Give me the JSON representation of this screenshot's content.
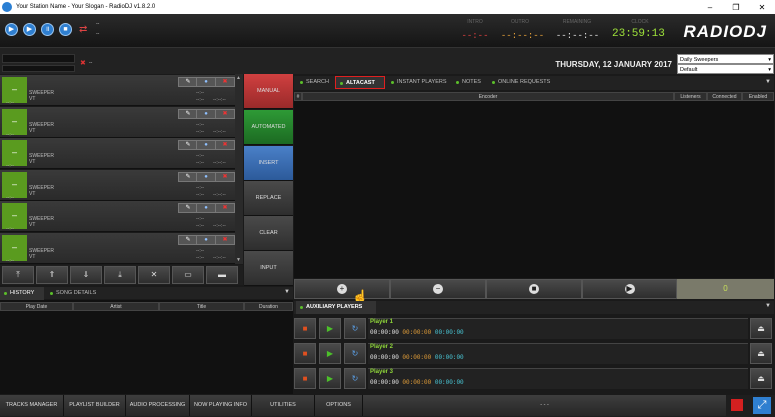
{
  "window": {
    "title": "Your Station Name - Your Slogan - RadioDJ v1.8.2.0",
    "min": "–",
    "max": "❐",
    "close": "✕"
  },
  "top": {
    "intro_label": "INTRO",
    "outro_label": "OUTRO",
    "remaining_label": "REMAINING",
    "clock_label": "CLOCK",
    "intro": "--:--",
    "outro": "--:--:--",
    "remaining": "--:--:--",
    "clock": "23:59:13",
    "logo": "RADIODJ",
    "player_label": "--",
    "player_label2": "--"
  },
  "date": "THURSDAY, 12 JANUARY 2017",
  "selectors": {
    "rotation": "Daily Sweepers",
    "mode": "Default"
  },
  "mini": {
    "value": "--"
  },
  "playlist": [
    {
      "title": "SWEEPER",
      "artist": "VT",
      "t1": "--:--",
      "t2": "--:--",
      "t3": "--:--",
      "t4": "--:--:--"
    },
    {
      "title": "SWEEPER",
      "artist": "VT",
      "t1": "--:--",
      "t2": "--:--",
      "t3": "--:--",
      "t4": "--:--:--"
    },
    {
      "title": "SWEEPER",
      "artist": "VT",
      "t1": "--:--",
      "t2": "--:--",
      "t3": "--:--",
      "t4": "--:--:--"
    },
    {
      "title": "SWEEPER",
      "artist": "VT",
      "t1": "--:--",
      "t2": "--:--",
      "t3": "--:--",
      "t4": "--:--:--"
    },
    {
      "title": "SWEEPER",
      "artist": "VT",
      "t1": "--:--",
      "t2": "--:--",
      "t3": "--:--",
      "t4": "--:--:--"
    },
    {
      "title": "SWEEPER",
      "artist": "VT",
      "t1": "--:--",
      "t2": "--:--",
      "t3": "--:--",
      "t4": "--:--:--"
    }
  ],
  "modes": [
    "MANUAL",
    "AUTOMATED",
    "INSERT",
    "REPLACE",
    "CLEAR",
    "INPUT"
  ],
  "history": {
    "tabs": [
      "HISTORY",
      "SONG DETAILS"
    ],
    "columns": [
      "Play Date",
      "Artist",
      "Title",
      "Duration"
    ]
  },
  "right_tabs": [
    "SEARCH",
    "ALTACAST",
    "INSTANT PLAYERS",
    "NOTES",
    "ONLINE REQUESTS"
  ],
  "altacast": {
    "columns": [
      "#",
      "Encoder",
      "Listeners",
      "Connected",
      "Enabled"
    ],
    "count": "0"
  },
  "aux": {
    "title": "AUXILIARY PLAYERS",
    "players": [
      {
        "name": "Player 1",
        "a": "00:00:00",
        "b": "00:00:00",
        "c": "00:00:00"
      },
      {
        "name": "Player 2",
        "a": "00:00:00",
        "b": "00:00:00",
        "c": "00:00:00"
      },
      {
        "name": "Player 3",
        "a": "00:00:00",
        "b": "00:00:00",
        "c": "00:00:00"
      }
    ]
  },
  "bottom": [
    "TRACKS MANAGER",
    "PLAYLIST BUILDER",
    "AUDIO PROCESSING",
    "NOW PLAYING INFO",
    "UTILITIES",
    "OPTIONS",
    "- - -"
  ],
  "colors": {
    "manual": "#c0392b",
    "automated": "#27882f",
    "insert": "#3a6fb5",
    "accent_green": "#5cbf2a",
    "clock": "#9ee33a",
    "time_red": "#e04040",
    "time_orange": "#e8a23a"
  }
}
